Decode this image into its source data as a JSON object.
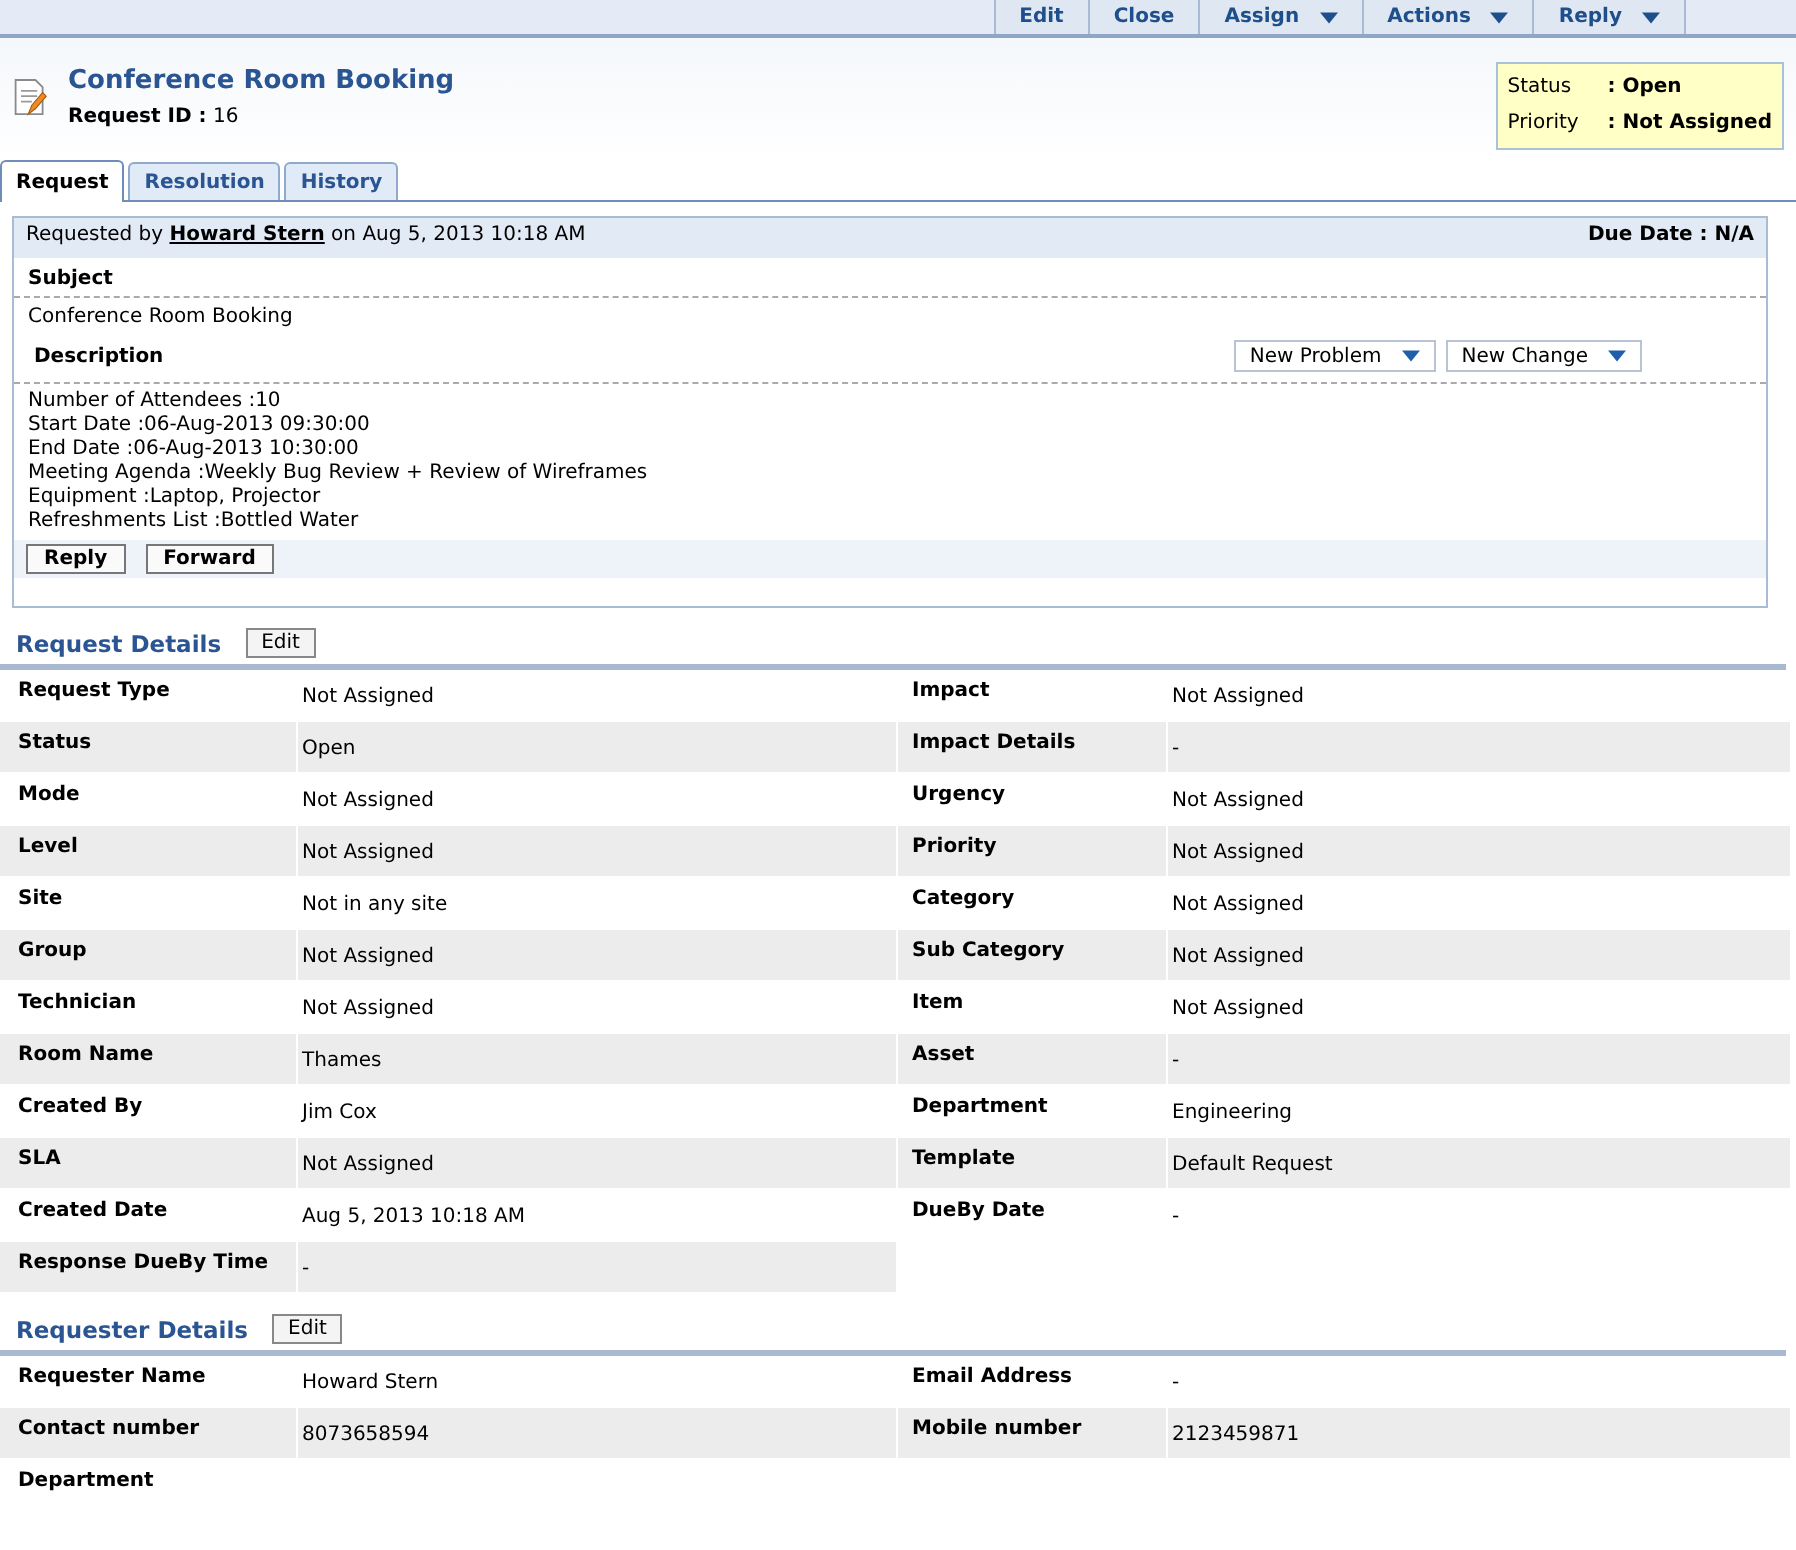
{
  "toolbar": [
    {
      "label": "Edit",
      "dropdown": false
    },
    {
      "label": "Close",
      "dropdown": false
    },
    {
      "label": "Assign",
      "dropdown": true
    },
    {
      "label": "Actions",
      "dropdown": true
    },
    {
      "label": "Reply",
      "dropdown": true
    }
  ],
  "header": {
    "title": "Conference Room Booking",
    "id_label": "Request ID :",
    "id_value": "16",
    "status": [
      {
        "label": "Status",
        "value": ": Open"
      },
      {
        "label": "Priority",
        "value": ": Not Assigned"
      }
    ]
  },
  "tabs": [
    {
      "label": "Request",
      "selected": true
    },
    {
      "label": "Resolution",
      "selected": false
    },
    {
      "label": "History",
      "selected": false
    }
  ],
  "request": {
    "by_prefix": "Requested by",
    "by_name": "Howard Stern",
    "by_suffix": "on Aug 5, 2013 10:18 AM",
    "due": "Due Date : N/A",
    "subject_label": "Subject",
    "subject": "Conference Room Booking",
    "description_label": "Description",
    "menus": [
      "New Problem",
      "New Change"
    ],
    "description": [
      "Number of Attendees :10",
      "Start Date :06-Aug-2013 09:30:00",
      "End Date :06-Aug-2013 10:30:00",
      "Meeting Agenda :Weekly Bug Review + Review of Wireframes",
      "Equipment :Laptop, Projector",
      "Refreshments List :Bottled Water"
    ],
    "buttons": [
      "Reply",
      "Forward"
    ]
  },
  "sections": [
    {
      "title": "Request Details",
      "edit": "Edit",
      "rows": [
        {
          "left": {
            "label": "Request Type",
            "value": "Not Assigned"
          },
          "right": {
            "label": "Impact",
            "value": "Not Assigned"
          }
        },
        {
          "left": {
            "label": "Status",
            "value": "Open"
          },
          "right": {
            "label": "Impact Details",
            "value": "-"
          }
        },
        {
          "left": {
            "label": "Mode",
            "value": "Not Assigned"
          },
          "right": {
            "label": "Urgency",
            "value": "Not Assigned"
          }
        },
        {
          "left": {
            "label": "Level",
            "value": "Not Assigned"
          },
          "right": {
            "label": "Priority",
            "value": "Not Assigned"
          }
        },
        {
          "left": {
            "label": "Site",
            "value": "Not in any site"
          },
          "right": {
            "label": "Category",
            "value": "Not Assigned"
          }
        },
        {
          "left": {
            "label": "Group",
            "value": "Not Assigned"
          },
          "right": {
            "label": "Sub Category",
            "value": "Not Assigned"
          }
        },
        {
          "left": {
            "label": "Technician",
            "value": "Not Assigned"
          },
          "right": {
            "label": "Item",
            "value": "Not Assigned"
          }
        },
        {
          "left": {
            "label": "Room Name",
            "value": "Thames"
          },
          "right": {
            "label": "Asset",
            "value": "-"
          }
        },
        {
          "left": {
            "label": "Created By",
            "value": "Jim Cox"
          },
          "right": {
            "label": "Department",
            "value": "Engineering"
          }
        },
        {
          "left": {
            "label": "SLA",
            "value": "Not Assigned"
          },
          "right": {
            "label": "Template",
            "value": "Default Request"
          }
        },
        {
          "left": {
            "label": "Created Date",
            "value": "Aug 5, 2013 10:18 AM"
          },
          "right": {
            "label": "DueBy Date",
            "value": "-"
          }
        },
        {
          "left": {
            "label": "Response DueBy Time",
            "value": "-"
          }
        }
      ]
    },
    {
      "title": "Requester Details",
      "edit": "Edit",
      "rows": [
        {
          "left": {
            "label": "Requester Name",
            "value": "Howard Stern"
          },
          "right": {
            "label": "Email Address",
            "value": "-"
          }
        },
        {
          "left": {
            "label": "Contact number",
            "value": "8073658594"
          },
          "right": {
            "label": "Mobile number",
            "value": "2123459871"
          }
        },
        {
          "left": {
            "label": "Department"
          }
        }
      ]
    }
  ]
}
